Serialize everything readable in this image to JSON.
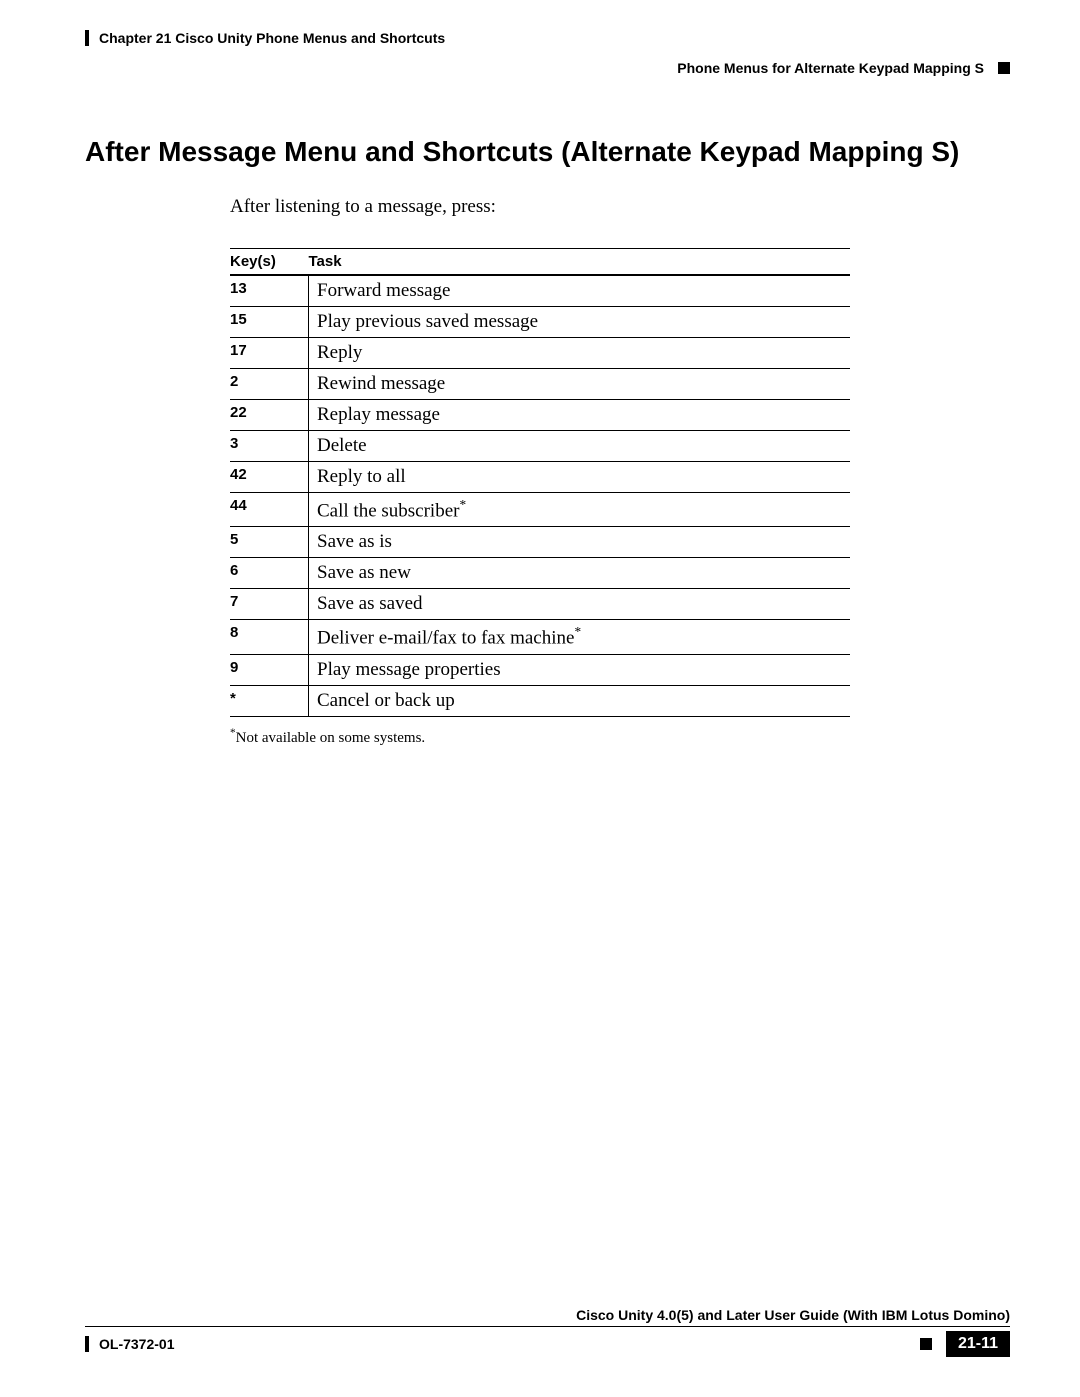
{
  "header": {
    "chapter": "Chapter 21    Cisco Unity Phone Menus and Shortcuts",
    "section": "Phone Menus for Alternate Keypad Mapping S"
  },
  "title": "After Message Menu and Shortcuts (Alternate Keypad Mapping S)",
  "intro": "After listening to a message, press:",
  "table": {
    "headers": {
      "keys": "Key(s)",
      "task": "Task"
    },
    "rows": [
      {
        "keys": "13",
        "task": "Forward message",
        "star": false
      },
      {
        "keys": "15",
        "task": "Play previous saved message",
        "star": false
      },
      {
        "keys": "17",
        "task": "Reply",
        "star": false
      },
      {
        "keys": "2",
        "task": "Rewind message",
        "star": false
      },
      {
        "keys": "22",
        "task": "Replay message",
        "star": false
      },
      {
        "keys": "3",
        "task": "Delete",
        "star": false
      },
      {
        "keys": "42",
        "task": "Reply to all",
        "star": false
      },
      {
        "keys": "44",
        "task": "Call the subscriber",
        "star": true
      },
      {
        "keys": "5",
        "task": "Save as is",
        "star": false
      },
      {
        "keys": "6",
        "task": "Save as new",
        "star": false
      },
      {
        "keys": "7",
        "task": "Save as saved",
        "star": false
      },
      {
        "keys": "8",
        "task": "Deliver e-mail/fax to fax machine",
        "star": true
      },
      {
        "keys": "9",
        "task": "Play message properties",
        "star": false
      },
      {
        "keys": "*",
        "task": "Cancel or back up",
        "star": false
      }
    ],
    "footnote": "Not available on some systems."
  },
  "footer": {
    "guide": "Cisco Unity 4.0(5) and Later User Guide (With IBM Lotus Domino)",
    "doc_id": "OL-7372-01",
    "page": "21-11"
  }
}
